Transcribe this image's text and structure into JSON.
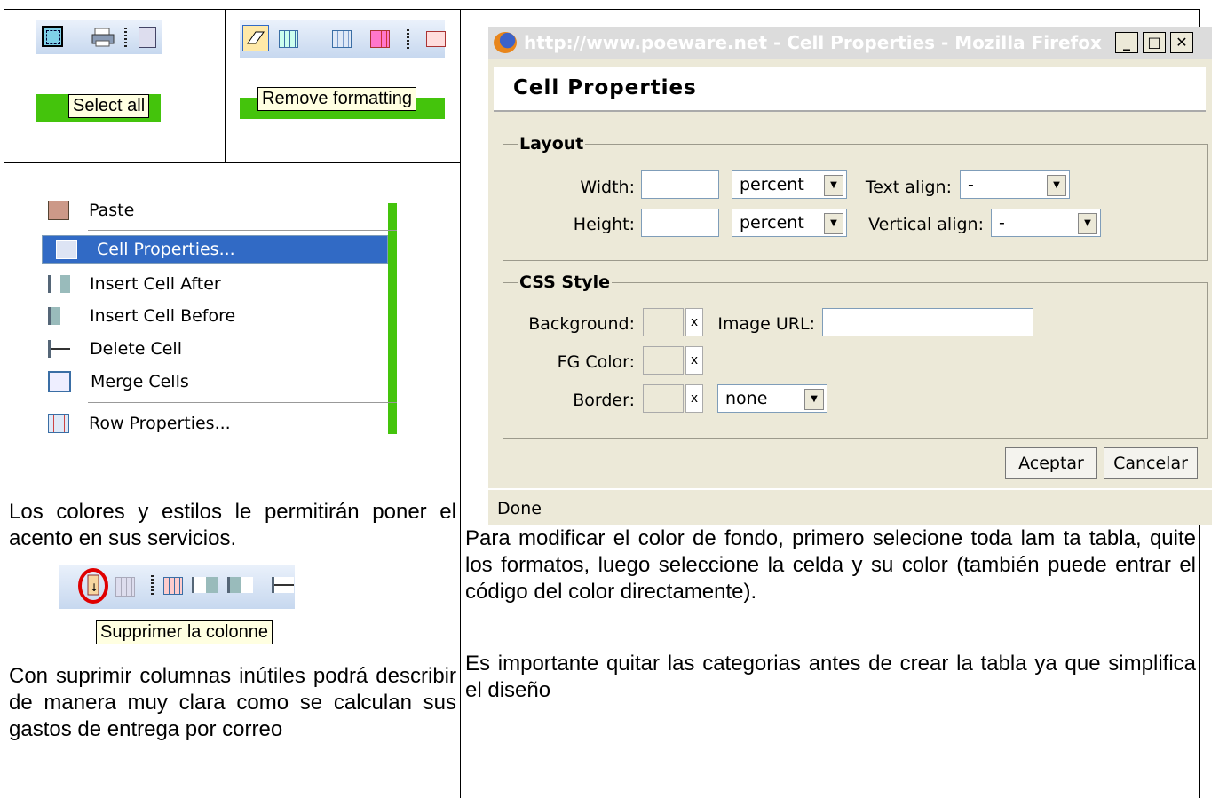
{
  "top_left": {
    "tooltip": "Select all",
    "icons": [
      "select-all-icon",
      "print-icon",
      "source-icon"
    ]
  },
  "top_middle": {
    "tooltip": "Remove formatting",
    "icons": [
      "eraser-icon",
      "table-icon",
      "table-grid-icon",
      "table-red-icon"
    ]
  },
  "context_menu": {
    "items": [
      {
        "label": "Paste",
        "icon": "paste-icon"
      },
      {
        "label": "Cell Properties...",
        "icon": "cell-properties-icon",
        "selected": true
      },
      {
        "label": "Insert Cell After",
        "icon": "insert-cell-after-icon"
      },
      {
        "label": "Insert Cell Before",
        "icon": "insert-cell-before-icon"
      },
      {
        "label": "Delete Cell",
        "icon": "delete-cell-icon"
      },
      {
        "label": "Merge Cells",
        "icon": "merge-cells-icon"
      },
      {
        "label": "Row Properties...",
        "icon": "row-properties-icon"
      }
    ]
  },
  "left_text_1": "Los colores y estilos le permitirán poner el acento en sus servicios.",
  "bottom_left": {
    "tooltip": "Supprimer la colonne",
    "icons": [
      "delete-column-icon",
      "column-icon",
      "cell-properties-icon",
      "insert-cell-after-icon",
      "insert-cell-before-icon",
      "delete-cell-icon"
    ]
  },
  "left_text_2": "Con suprimir columnas inútiles podrá describir de manera muy clara como se calculan sus gastos de entrega por correo",
  "dialog": {
    "window_title": "http://www.poeware.net - Cell Properties - Mozilla Firefox",
    "header": "Cell Properties",
    "layout": {
      "legend": "Layout",
      "width_label": "Width:",
      "width_value": "",
      "width_unit": "percent",
      "height_label": "Height:",
      "height_value": "",
      "height_unit": "percent",
      "text_align_label": "Text align:",
      "text_align_value": "-",
      "vertical_align_label": "Vertical align:",
      "vertical_align_value": "-"
    },
    "css_style": {
      "legend": "CSS Style",
      "background_label": "Background:",
      "image_url_label": "Image URL:",
      "image_url_value": "",
      "fg_color_label": "FG Color:",
      "border_label": "Border:",
      "border_value": "none",
      "clear_symbol": "x"
    },
    "accept_button": "Aceptar",
    "cancel_button": "Cancelar",
    "status": "Done"
  },
  "right_text_1": "Para modificar el color de fondo, primero selecione toda lam ta tabla, quite los formatos, luego seleccione la celda y su color (también puede entrar el código del color directamente).",
  "right_text_2": "Es importante quitar las categorias antes de crear la tabla ya que simplifica el diseño",
  "colors": {
    "green_bar": "#44c40c",
    "menu_highlight": "#316ac5",
    "titlebar_text": "#ffffff",
    "tooltip_bg": "#ffffe1",
    "highlight_circle": "#e00000"
  }
}
